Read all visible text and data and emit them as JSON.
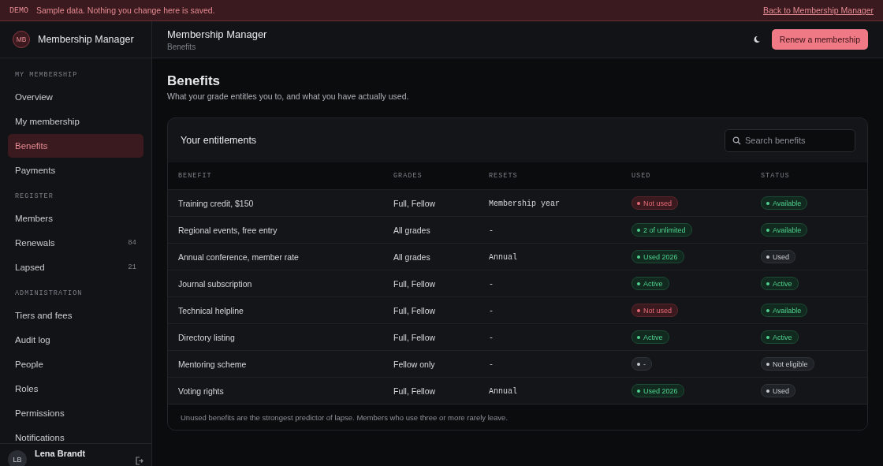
{
  "banner": {
    "tag": "DEMO",
    "message": "Sample data. Nothing you change here is saved.",
    "link": "Back to Membership Manager"
  },
  "sidebar": {
    "brand": {
      "initials": "MB",
      "name": "Membership Manager"
    },
    "sections": [
      {
        "title": "MY MEMBERSHIP",
        "items": [
          {
            "label": "Overview",
            "selected": false
          },
          {
            "label": "My membership",
            "selected": false
          },
          {
            "label": "Benefits",
            "selected": true
          },
          {
            "label": "Payments",
            "selected": false
          }
        ]
      },
      {
        "title": "REGISTER",
        "items": [
          {
            "label": "Members",
            "selected": false
          },
          {
            "label": "Renewals",
            "count": "84",
            "selected": false
          },
          {
            "label": "Lapsed",
            "count": "21",
            "selected": false
          }
        ]
      },
      {
        "title": "ADMINISTRATION",
        "items": [
          {
            "label": "Tiers and fees",
            "selected": false
          },
          {
            "label": "Audit log",
            "selected": false
          },
          {
            "label": "People",
            "selected": false
          },
          {
            "label": "Roles",
            "selected": false
          },
          {
            "label": "Permissions",
            "selected": false
          },
          {
            "label": "Notifications",
            "selected": false
          }
        ]
      }
    ],
    "user": {
      "initials": "LB",
      "name": "Lena Brandt"
    }
  },
  "header": {
    "title": "Membership Manager",
    "breadcrumb": "Benefits",
    "action": "Renew a membership"
  },
  "page": {
    "title": "Benefits",
    "subtitle": "What your grade entitles you to, and what you have actually used."
  },
  "card": {
    "title": "Your entitlements",
    "search": {
      "placeholder": "Search benefits"
    },
    "table": {
      "columns": [
        "BENEFIT",
        "GRADES",
        "RESETS",
        "USED",
        "STATUS"
      ],
      "rows": [
        {
          "benefit": "Training credit, $150",
          "grades": "Full, Fellow",
          "resets": "Membership year",
          "used": {
            "label": "Not used",
            "kind": "red"
          },
          "status": {
            "label": "Available",
            "kind": "green"
          }
        },
        {
          "benefit": "Regional events, free entry",
          "grades": "All grades",
          "resets": "-",
          "used": {
            "label": "2 of unlimited",
            "kind": "green"
          },
          "status": {
            "label": "Available",
            "kind": "green"
          }
        },
        {
          "benefit": "Annual conference, member rate",
          "grades": "All grades",
          "resets": "Annual",
          "used": {
            "label": "Used 2026",
            "kind": "green"
          },
          "status": {
            "label": "Used",
            "kind": "grey"
          }
        },
        {
          "benefit": "Journal subscription",
          "grades": "Full, Fellow",
          "resets": "-",
          "used": {
            "label": "Active",
            "kind": "green"
          },
          "status": {
            "label": "Active",
            "kind": "green"
          }
        },
        {
          "benefit": "Technical helpline",
          "grades": "Full, Fellow",
          "resets": "-",
          "used": {
            "label": "Not used",
            "kind": "red"
          },
          "status": {
            "label": "Available",
            "kind": "green"
          }
        },
        {
          "benefit": "Directory listing",
          "grades": "Full, Fellow",
          "resets": "-",
          "used": {
            "label": "Active",
            "kind": "green"
          },
          "status": {
            "label": "Active",
            "kind": "green"
          }
        },
        {
          "benefit": "Mentoring scheme",
          "grades": "Fellow only",
          "resets": "-",
          "used": {
            "label": "-",
            "kind": "grey"
          },
          "status": {
            "label": "Not eligible",
            "kind": "grey"
          }
        },
        {
          "benefit": "Voting rights",
          "grades": "Full, Fellow",
          "resets": "Annual",
          "used": {
            "label": "Used 2026",
            "kind": "green"
          },
          "status": {
            "label": "Used",
            "kind": "grey"
          }
        }
      ]
    },
    "footnote": "Unused benefits are the strongest predictor of lapse. Members who use three or more rarely leave."
  }
}
